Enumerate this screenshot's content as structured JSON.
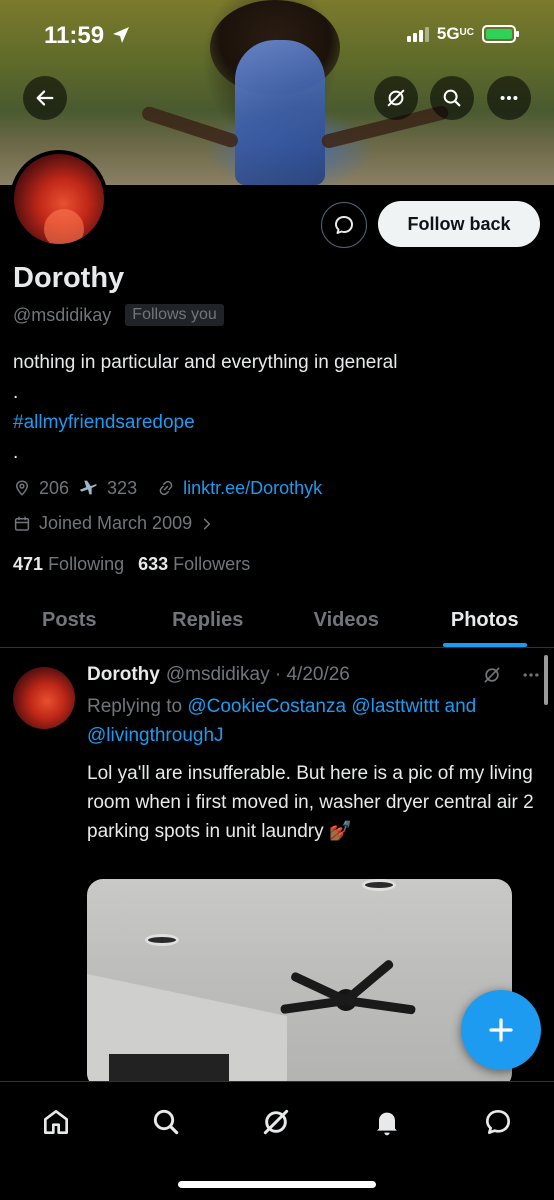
{
  "status_bar": {
    "time": "11:59",
    "network": "5G",
    "network_sub": "UC"
  },
  "colors": {
    "accent": "#1d9bf0",
    "background": "#000000",
    "secondary_text": "#71767b",
    "battery": "#30d158"
  },
  "header": {
    "back_icon": "arrow-left-icon",
    "grok_icon": "grok-icon",
    "search_icon": "search-icon",
    "more_icon": "more-horizontal-icon"
  },
  "profile": {
    "name": "Dorothy",
    "handle": "@msdidikay",
    "follows_you": "Follows you",
    "follow_back_label": "Follow back",
    "bio_line1": "nothing in particular and everything in general",
    "bio_dot1": ".",
    "bio_hashtag": "#allmyfriendsaredope",
    "bio_dot2": ".",
    "location_a": "206",
    "location_b": "323",
    "link": "linktr.ee/Dorothyk",
    "joined": "Joined March 2009",
    "following_count": "471",
    "following_label": "Following",
    "followers_count": "633",
    "followers_label": "Followers"
  },
  "tabs": [
    {
      "label": "Posts",
      "active": false
    },
    {
      "label": "Replies",
      "active": false
    },
    {
      "label": "Videos",
      "active": false
    },
    {
      "label": "Photos",
      "active": true
    }
  ],
  "tweet": {
    "name": "Dorothy",
    "handle_date": "@msdidikay · 4/20/26",
    "replying_prefix": "Replying to",
    "mention1": "@CookieCostanza",
    "mention2": "@lasttwittt",
    "and_word": "and",
    "mention3": "@livingthroughJ",
    "text": "Lol ya'll are insufferable. But here is a pic of my living room when i first moved in, washer dryer central air 2 parking spots in unit laundry 💅🏾"
  },
  "bottom_nav": [
    "home-icon",
    "search-icon",
    "grok-icon",
    "notifications-icon",
    "messages-icon"
  ]
}
